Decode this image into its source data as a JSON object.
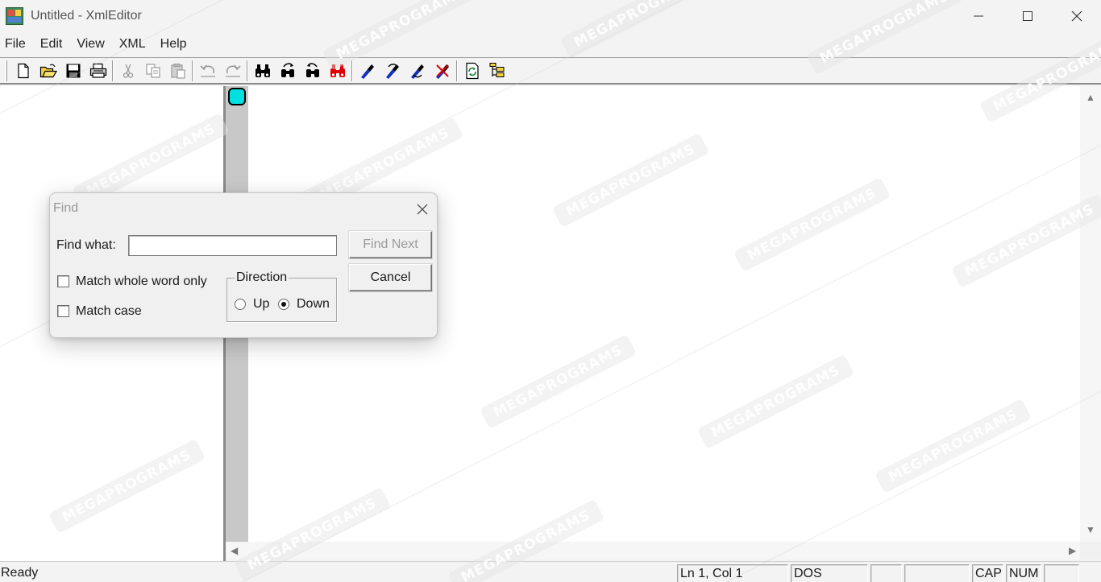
{
  "window": {
    "title": "Untitled - XmlEditor",
    "controls": [
      "minimize",
      "maximize",
      "close"
    ]
  },
  "menu": {
    "items": [
      "File",
      "Edit",
      "View",
      "XML",
      "Help"
    ]
  },
  "toolbar": {
    "buttons": [
      {
        "name": "new-icon",
        "tooltip": ""
      },
      {
        "name": "open-icon",
        "tooltip": ""
      },
      {
        "name": "save-icon",
        "tooltip": ""
      },
      {
        "name": "print-icon",
        "tooltip": ""
      },
      {
        "name": "cut-icon",
        "tooltip": ""
      },
      {
        "name": "copy-icon",
        "tooltip": ""
      },
      {
        "name": "paste-icon",
        "tooltip": ""
      },
      {
        "name": "undo-icon",
        "tooltip": ""
      },
      {
        "name": "redo-icon",
        "tooltip": ""
      },
      {
        "name": "find-icon",
        "tooltip": ""
      },
      {
        "name": "find-next-icon",
        "tooltip": ""
      },
      {
        "name": "find-prev-icon",
        "tooltip": ""
      },
      {
        "name": "replace-icon",
        "tooltip": ""
      },
      {
        "name": "bookmark-icon",
        "tooltip": ""
      },
      {
        "name": "next-bookmark-icon",
        "tooltip": ""
      },
      {
        "name": "prev-bookmark-icon",
        "tooltip": ""
      },
      {
        "name": "clear-bookmarks-icon",
        "tooltip": ""
      },
      {
        "name": "validate-icon",
        "tooltip": ""
      },
      {
        "name": "tree-icon",
        "tooltip": ""
      }
    ]
  },
  "status": {
    "ready": "Ready",
    "position": "Ln 1, Col 1",
    "line_endings": "DOS",
    "caps": "CAP",
    "num": "NUM"
  },
  "find_dialog": {
    "title": "Find",
    "find_what_label": "Find what:",
    "find_what_value": "",
    "find_next_label": "Find Next",
    "cancel_label": "Cancel",
    "match_whole_word_label": "Match whole word only",
    "match_whole_word_checked": false,
    "match_case_label": "Match case",
    "match_case_checked": false,
    "direction_label": "Direction",
    "direction_up_label": "Up",
    "direction_down_label": "Down",
    "direction_selected": "Down"
  },
  "watermark": {
    "text": "MEGAPROGRAMS"
  },
  "colors": {
    "line_marker": "#00e0e0",
    "gutter": "#c8c8c8",
    "find_icon_red": "#e00000",
    "bookmark_blue": "#1030c0"
  }
}
